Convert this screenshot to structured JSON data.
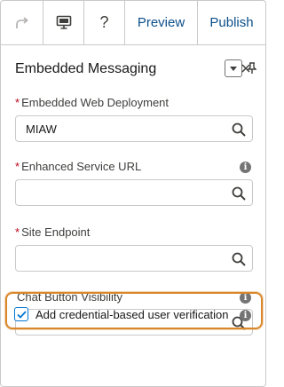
{
  "toolbar": {
    "redo_icon": "redo-icon",
    "device_icon": "desktop-icon",
    "help_label": "?",
    "preview_label": "Preview",
    "publish_label": "Publish"
  },
  "panel": {
    "title": "Embedded Messaging",
    "fields": [
      {
        "label": "Embedded Web Deployment",
        "required": "*",
        "value": "MIAW"
      },
      {
        "label": "Enhanced Service URL",
        "required": "*",
        "value": ""
      },
      {
        "label": "Site Endpoint",
        "required": "*",
        "value": ""
      },
      {
        "label": "Chat Button Visibility",
        "required": "",
        "value": ""
      }
    ],
    "checkbox": {
      "label": "Add credential-based user verification",
      "checked": true
    }
  },
  "colors": {
    "accent": "#0176d3",
    "link": "#0b4f8a",
    "required": "#ba0517",
    "highlight": "#d9872a"
  }
}
